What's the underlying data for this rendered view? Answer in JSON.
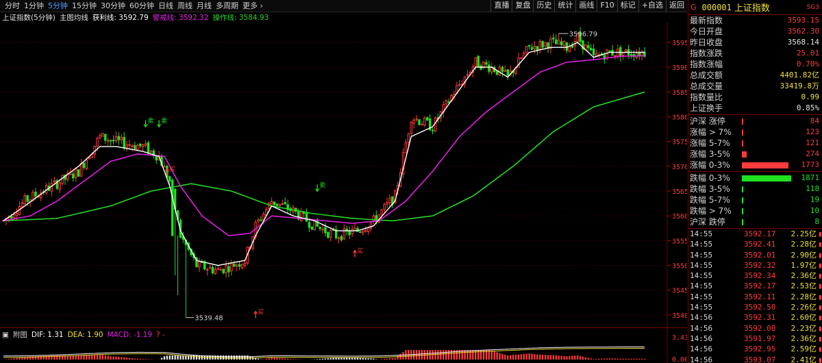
{
  "toolbar": {
    "periods": [
      "分时",
      "1分钟",
      "5分钟",
      "15分钟",
      "30分钟",
      "60分钟",
      "日线",
      "周线",
      "月线",
      "多周期",
      "更多"
    ],
    "active_period": 2,
    "right_tools": [
      "直播",
      "复盘",
      "历史",
      "统计",
      "画线",
      "F10",
      "标记",
      "+自选",
      "返回"
    ]
  },
  "chart_header": {
    "title": "上证指数(5分钟)",
    "ma_label": "主图均线",
    "profit_line": "获利线: 3592.79",
    "warn_line": "警戒线: 3592.32",
    "op_line": "操作线: 3584.93"
  },
  "colors": {
    "up": "#ff3b3b",
    "down": "#1fe01f",
    "white_line": "#ffffff",
    "magenta_line": "#e020e0",
    "green_line": "#22d922",
    "yellow": "#f2e13a",
    "grid": "#5a0000"
  },
  "chart_data": {
    "type": "candlestick",
    "ylim": [
      3537.5,
      3599
    ],
    "y_ticks": [
      3540,
      3545,
      3550,
      3555,
      3560,
      3565,
      3570,
      3575,
      3580,
      3585,
      3590,
      3595
    ],
    "annotations": {
      "high": "3596.79",
      "low": "3539.48",
      "sell": "卖",
      "buy": "买"
    },
    "signals": [
      {
        "kind": "sell",
        "bar": 53,
        "y": 3578.5
      },
      {
        "kind": "sell",
        "bar": 58,
        "y": 3578.5
      },
      {
        "kind": "sell",
        "bar": 117,
        "y": 3565.5
      },
      {
        "kind": "buy",
        "bar": 61,
        "y": 3569
      },
      {
        "kind": "buy",
        "bar": 131,
        "y": 3552.5
      },
      {
        "kind": "buy",
        "bar": 94,
        "y": 3540.2
      }
    ],
    "bar_count": 240,
    "key_points": [
      [
        0,
        3559
      ],
      [
        8,
        3563
      ],
      [
        18,
        3566
      ],
      [
        28,
        3569
      ],
      [
        36,
        3576
      ],
      [
        42,
        3575
      ],
      [
        52,
        3574
      ],
      [
        58,
        3572
      ],
      [
        62,
        3567
      ],
      [
        66,
        3556
      ],
      [
        72,
        3550
      ],
      [
        80,
        3549
      ],
      [
        90,
        3551
      ],
      [
        94,
        3558
      ],
      [
        100,
        3563
      ],
      [
        108,
        3561
      ],
      [
        116,
        3558
      ],
      [
        124,
        3556
      ],
      [
        132,
        3557
      ],
      [
        138,
        3559
      ],
      [
        146,
        3564
      ],
      [
        152,
        3580
      ],
      [
        160,
        3578
      ],
      [
        168,
        3585
      ],
      [
        176,
        3591
      ],
      [
        182,
        3590
      ],
      [
        188,
        3588
      ],
      [
        196,
        3594
      ],
      [
        204,
        3595
      ],
      [
        210,
        3594
      ],
      [
        214,
        3596
      ],
      [
        220,
        3592
      ],
      [
        226,
        3593
      ],
      [
        234,
        3593
      ],
      [
        239,
        3593
      ]
    ],
    "ma_white_points": [
      [
        0,
        3559
      ],
      [
        8,
        3562
      ],
      [
        18,
        3566
      ],
      [
        28,
        3570
      ],
      [
        36,
        3574
      ],
      [
        42,
        3574
      ],
      [
        52,
        3573
      ],
      [
        58,
        3572
      ],
      [
        62,
        3566
      ],
      [
        66,
        3557
      ],
      [
        72,
        3551
      ],
      [
        80,
        3550
      ],
      [
        90,
        3551
      ],
      [
        94,
        3556
      ],
      [
        100,
        3562
      ],
      [
        108,
        3560
      ],
      [
        116,
        3559
      ],
      [
        124,
        3557
      ],
      [
        132,
        3557
      ],
      [
        138,
        3558
      ],
      [
        146,
        3563
      ],
      [
        152,
        3576
      ],
      [
        160,
        3578
      ],
      [
        168,
        3584
      ],
      [
        176,
        3590
      ],
      [
        182,
        3590
      ],
      [
        188,
        3588
      ],
      [
        196,
        3593
      ],
      [
        204,
        3594
      ],
      [
        210,
        3594
      ],
      [
        214,
        3595
      ],
      [
        220,
        3592
      ],
      [
        226,
        3593
      ],
      [
        239,
        3593
      ]
    ],
    "ma_magenta_points": [
      [
        0,
        3559
      ],
      [
        10,
        3560
      ],
      [
        20,
        3563
      ],
      [
        30,
        3567
      ],
      [
        40,
        3571
      ],
      [
        50,
        3572.5
      ],
      [
        60,
        3572
      ],
      [
        66,
        3566
      ],
      [
        74,
        3560
      ],
      [
        84,
        3556
      ],
      [
        92,
        3556.5
      ],
      [
        100,
        3560
      ],
      [
        110,
        3559.5
      ],
      [
        120,
        3559
      ],
      [
        130,
        3558.5
      ],
      [
        140,
        3559
      ],
      [
        150,
        3563
      ],
      [
        160,
        3569
      ],
      [
        170,
        3576
      ],
      [
        180,
        3581
      ],
      [
        190,
        3585
      ],
      [
        200,
        3589
      ],
      [
        210,
        3591
      ],
      [
        220,
        3591.5
      ],
      [
        230,
        3592.2
      ],
      [
        239,
        3592.3
      ]
    ],
    "ma_green_points": [
      [
        0,
        3559
      ],
      [
        20,
        3559.5
      ],
      [
        40,
        3562
      ],
      [
        55,
        3565
      ],
      [
        70,
        3566.5
      ],
      [
        85,
        3565
      ],
      [
        100,
        3562
      ],
      [
        115,
        3560.5
      ],
      [
        130,
        3559.5
      ],
      [
        145,
        3559
      ],
      [
        160,
        3560
      ],
      [
        175,
        3564
      ],
      [
        190,
        3570
      ],
      [
        205,
        3577
      ],
      [
        220,
        3582
      ],
      [
        239,
        3585
      ]
    ],
    "sub_panel": {
      "title": "附图",
      "dif": "DIF: 1.31",
      "dea": "DEA: 1.90",
      "macd": "MACD: -1.19",
      "extra": "? -",
      "y_ticks": [
        "0.00"
      ],
      "top_tick": "3.43"
    }
  },
  "panel": {
    "marker": "G",
    "code": "000001",
    "name": "上证指数",
    "market": "SG3",
    "stats": [
      {
        "label": "最新指数",
        "value": "3593.15",
        "color": "#ff3b3b"
      },
      {
        "label": "今日开盘",
        "value": "3562.30",
        "color": "#ff3b3b"
      },
      {
        "label": "昨日收盘",
        "value": "3568.14",
        "color": "#e6e6e6"
      },
      {
        "label": "指数涨跌",
        "value": "25.01",
        "color": "#ff3b3b"
      },
      {
        "label": "指数涨幅",
        "value": "0.70%",
        "color": "#ff3b3b"
      },
      {
        "label": "总成交额",
        "value": "4401.82亿",
        "color": "#f2e13a"
      },
      {
        "label": "总成交量",
        "value": "33419.8万",
        "color": "#f2e13a"
      },
      {
        "label": "指数量比",
        "value": "0.99",
        "color": "#f2e13a"
      },
      {
        "label": "上证换手",
        "value": "0.85%",
        "color": "#e6e6e6"
      }
    ],
    "up_rows": [
      {
        "label": "沪深  涨停",
        "value": "84",
        "fraction": 0.015
      },
      {
        "label": "涨幅 > 7%",
        "value": "123",
        "fraction": 0.025
      },
      {
        "label": "涨幅  5-7%",
        "value": "121",
        "fraction": 0.024
      },
      {
        "label": "涨幅  3-5%",
        "value": "274",
        "fraction": 0.09
      },
      {
        "label": "涨幅  0-3%",
        "value": "1773",
        "fraction": 0.92
      }
    ],
    "down_rows": [
      {
        "label": "跌幅  0-3%",
        "value": "1871",
        "fraction": 0.97
      },
      {
        "label": "跌幅  3-5%",
        "value": "118",
        "fraction": 0.03
      },
      {
        "label": "跌幅  5-7%",
        "value": "19",
        "fraction": 0.005
      },
      {
        "label": "跌幅 > 7%",
        "value": "10",
        "fraction": 0.004
      },
      {
        "label": "沪深  跌停",
        "value": "8",
        "fraction": 0.003
      }
    ],
    "ticks": [
      {
        "time": "14:55",
        "price": "3592.17",
        "vol": "2.25亿"
      },
      {
        "time": "14:55",
        "price": "3592.41",
        "vol": "2.28亿"
      },
      {
        "time": "14:55",
        "price": "3592.01",
        "vol": "2.90亿"
      },
      {
        "time": "14:55",
        "price": "3592.32",
        "vol": "1.97亿"
      },
      {
        "time": "14:55",
        "price": "3592.34",
        "vol": "2.36亿"
      },
      {
        "time": "14:55",
        "price": "3592.17",
        "vol": "2.53亿"
      },
      {
        "time": "14:55",
        "price": "3592.11",
        "vol": "2.28亿"
      },
      {
        "time": "14:55",
        "price": "3592.50",
        "vol": "2.26亿"
      },
      {
        "time": "14:56",
        "price": "3592.31",
        "vol": "2.60亿"
      },
      {
        "time": "14:56",
        "price": "3592.00",
        "vol": "2.23亿"
      },
      {
        "time": "14:56",
        "price": "3591.97",
        "vol": "2.36亿"
      },
      {
        "time": "14:56",
        "price": "3592.95",
        "vol": "2.59亿"
      },
      {
        "time": "14:56",
        "price": "3593.07",
        "vol": "2.41亿"
      }
    ]
  }
}
